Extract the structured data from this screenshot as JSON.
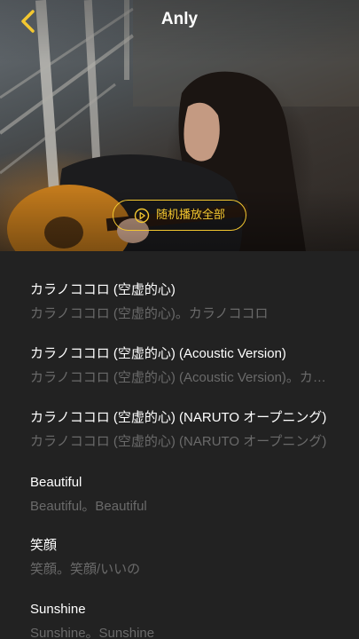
{
  "header": {
    "title": "Anly",
    "back_icon": "chevron-left-icon",
    "accent_color": "#f3c730"
  },
  "hero": {
    "shuffle_label": "随机播放全部",
    "shuffle_icon": "play-circle-icon"
  },
  "songs": [
    {
      "title": "カラノココロ (空虚的心)",
      "subtitle": "カラノココロ (空虚的心)。カラノココロ"
    },
    {
      "title": "カラノココロ (空虚的心) (Acoustic Version)",
      "subtitle": "カラノココロ (空虚的心) (Acoustic Version)。カラノココロ (Acoustic Version)"
    },
    {
      "title": "カラノココロ (空虚的心) (NARUTO オープニング)",
      "subtitle": "カラノココロ (空虚的心) (NARUTO オープニング)"
    },
    {
      "title": "Beautiful",
      "subtitle": "Beautiful。Beautiful"
    },
    {
      "title": "笑顔",
      "subtitle": "笑顔。笑顔/いいの"
    },
    {
      "title": "Sunshine",
      "subtitle": "Sunshine。Sunshine"
    }
  ]
}
